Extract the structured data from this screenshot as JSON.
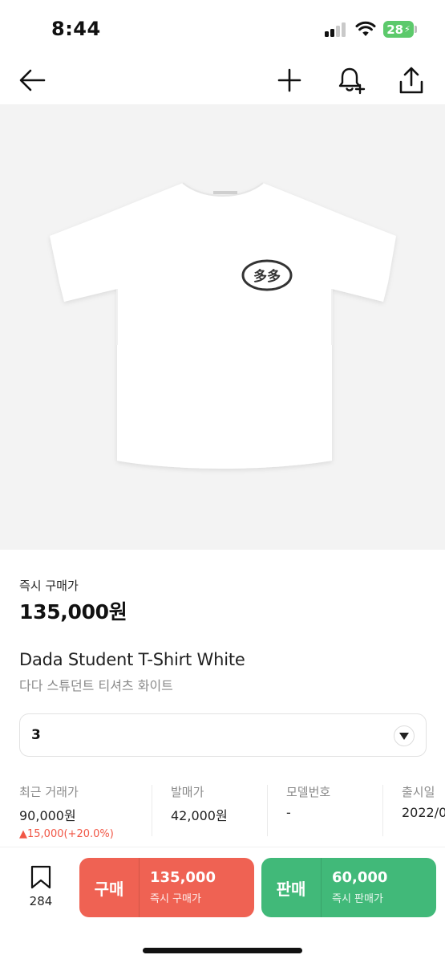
{
  "status_bar": {
    "time": "8:44",
    "battery": "28"
  },
  "product": {
    "price_label": "즉시 구매가",
    "price": "135,000원",
    "name_en": "Dada Student T-Shirt White",
    "name_ko": "다다 스튜던트 티셔츠 화이트",
    "shirt_print": "多多"
  },
  "size_select": {
    "value": "3"
  },
  "info": [
    {
      "label": "최근 거래가",
      "value": "90,000원",
      "change": "▲15,000(+20.0%)"
    },
    {
      "label": "발매가",
      "value": "42,000원"
    },
    {
      "label": "모델번호",
      "value": "-"
    },
    {
      "label": "출시일",
      "value": "2022/0"
    }
  ],
  "bottom": {
    "bookmark_count": "284",
    "buy": {
      "label": "구매",
      "price": "135,000",
      "sub": "즉시 구매가"
    },
    "sell": {
      "label": "판매",
      "price": "60,000",
      "sub": "즉시 판매가"
    }
  },
  "colors": {
    "buy": "#ef6253",
    "sell": "#41b979",
    "change_up": "#f15746",
    "battery": "#5cc96b"
  }
}
